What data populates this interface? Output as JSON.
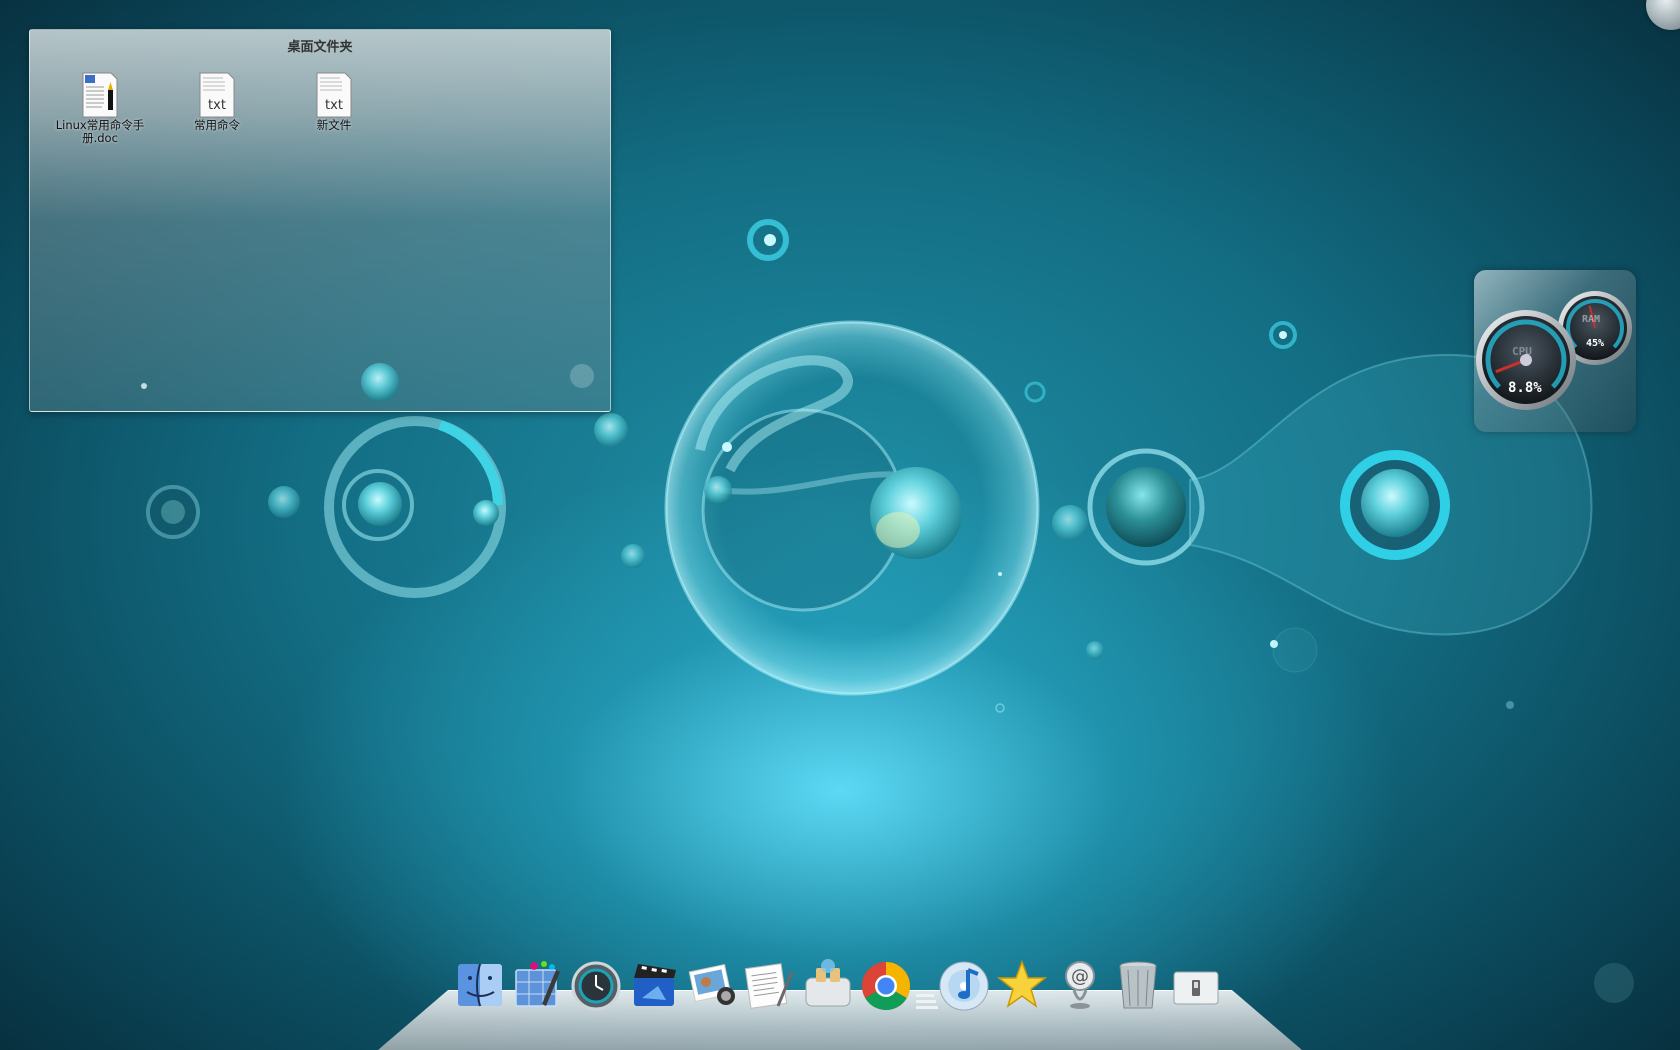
{
  "folder": {
    "title": "桌面文件夹",
    "files": [
      {
        "name": "Linux常用命令手册.doc",
        "icon": "doc-icon"
      },
      {
        "name": "常用命令",
        "icon": "txt-icon",
        "badge": "txt"
      },
      {
        "name": "新文件",
        "icon": "txt-icon",
        "badge": "txt"
      }
    ]
  },
  "monitor": {
    "cpu_label": "CPU",
    "cpu_value": "8.8%",
    "cpu_fraction": 0.088,
    "ram_label": "RAM",
    "ram_value": "45%",
    "ram_fraction": 0.45
  },
  "dock": {
    "items": [
      {
        "name": "finder-icon"
      },
      {
        "name": "dashboard-icon"
      },
      {
        "name": "time-machine-icon"
      },
      {
        "name": "imovie-icon"
      },
      {
        "name": "iphoto-icon"
      },
      {
        "name": "textedit-icon"
      },
      {
        "name": "toaster-icon"
      },
      {
        "name": "chrome-icon"
      },
      {
        "name": "stack-separator-icon"
      },
      {
        "name": "itunes-icon"
      },
      {
        "name": "star-icon"
      },
      {
        "name": "mail-icon"
      },
      {
        "name": "trash-icon"
      },
      {
        "name": "switch-icon"
      }
    ]
  },
  "colors": {
    "background_dark": "#072c3a",
    "background_mid": "#136d83",
    "glow": "#60defa"
  }
}
